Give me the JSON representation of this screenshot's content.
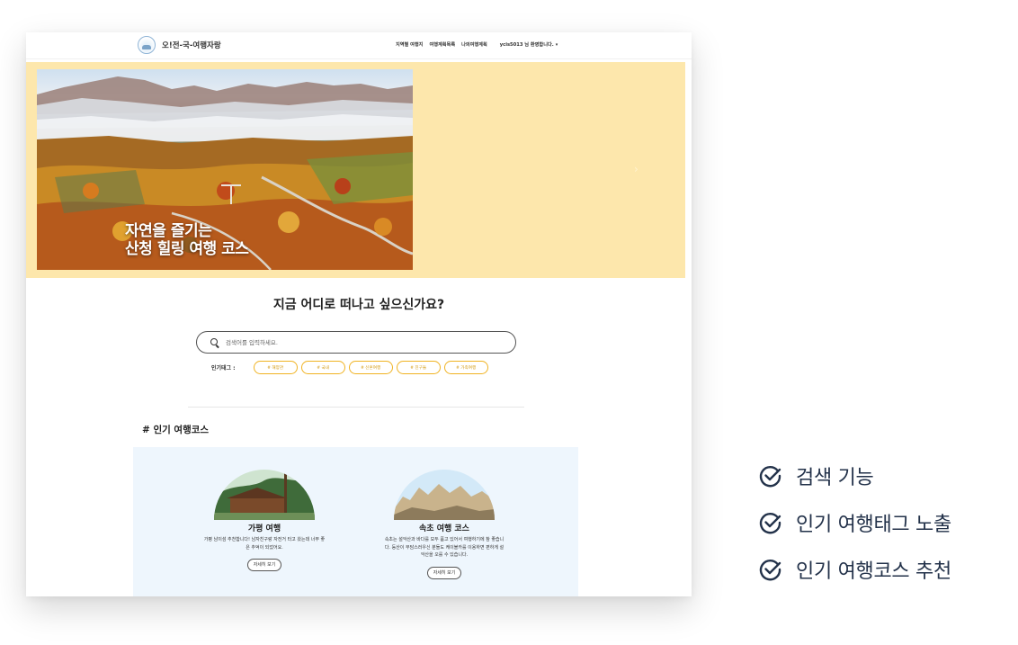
{
  "header": {
    "logo_text": "오!전-국-여행자랑",
    "nav": [
      "지역별 여행지",
      "여행계획목록",
      "나의여행계획"
    ],
    "user_greeting": "ycis5013 님 환영합니다.",
    "caret": "▾"
  },
  "banner": {
    "title_line1": "자연을 즐기는",
    "title_line2": "산청 힐링 여행 코스",
    "next_icon": "›"
  },
  "search": {
    "question": "지금 어디로 떠나고 싶으신가요?",
    "placeholder": "검색어를 입력하세요.",
    "tags_label": "인기태그 :",
    "tags": [
      "# 해양관",
      "# 국내",
      "# 신혼여행",
      "# 친구들",
      "# 가족여행"
    ]
  },
  "courses": {
    "title": "# 인기 여행코스",
    "items": [
      {
        "name": "가평 여행",
        "desc": "가평 남이섬 추천합니다! 남자친구랑 자전거 타고 왔는데 너무 좋은 추억이 되었어요.",
        "button": "자세히 보기"
      },
      {
        "name": "속초 여행 코스",
        "desc": "속초는 설악산과 바다를 모두 품고 있어서 여행하기에 참 좋습니다. 등산이 부담스러우신 분들도 케이블카를 이용하면 편하게 설악산을 오를 수 있습니다.",
        "button": "자세히 보기"
      }
    ]
  },
  "features": [
    "검색 기능",
    "인기 여행태그 노출",
    "인기 여행코스 추천"
  ],
  "colors": {
    "banner_bg": "#fde7ac",
    "tag_accent": "#f0b322",
    "courses_bg": "#eef6fd",
    "feature_text": "#23324a"
  }
}
